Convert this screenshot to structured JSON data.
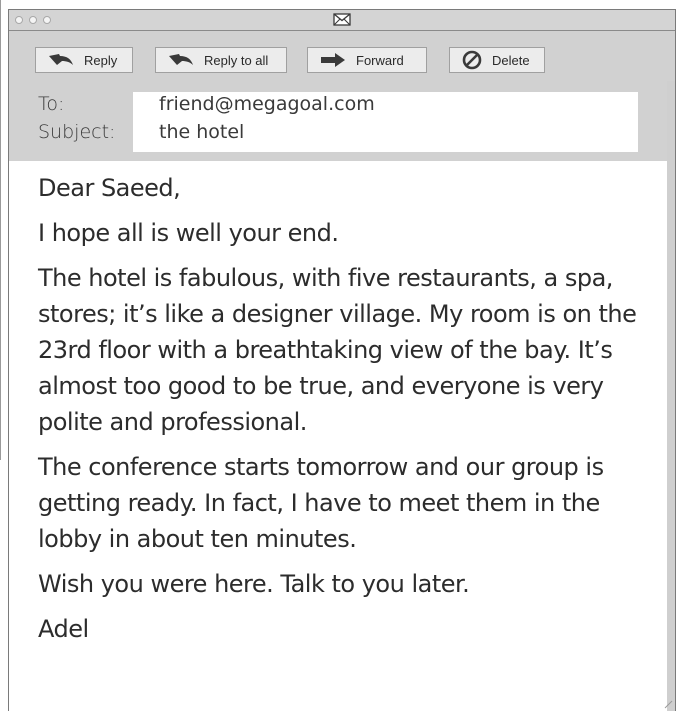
{
  "toolbar": {
    "reply_label": "Reply",
    "reply_all_label": "Reply to all",
    "forward_label": "Forward",
    "delete_label": "Delete"
  },
  "headers": {
    "to_label": "To:",
    "to_value": "friend@megagoal.com",
    "subject_label": "Subject:",
    "subject_value": "the hotel"
  },
  "message": {
    "greeting": "Dear Saeed,",
    "line1": "I hope all is well your end.",
    "paragraph1": "The hotel is fabulous, with five restaurants, a spa, stores; it’s like a designer village. My room is on the 23rd floor with a breathtaking view of the bay. It’s almost too good to be true, and everyone is very polite and professional.",
    "paragraph2": "The conference starts tomorrow and our group is getting ready. In fact, I have to meet them in the lobby in about ten minutes.",
    "closing": "Wish you were here. Talk to you later.",
    "signature": "Adel"
  },
  "icons": {
    "title": "envelope-icon",
    "reply": "reply-arrow-icon",
    "reply_all": "reply-all-arrow-icon",
    "forward": "forward-arrow-icon",
    "delete": "no-entry-icon"
  },
  "colors": {
    "chrome": "#d1d1d1",
    "button": "#ececec",
    "icon": "#3a3a3a",
    "text": "#2c2c2c"
  }
}
